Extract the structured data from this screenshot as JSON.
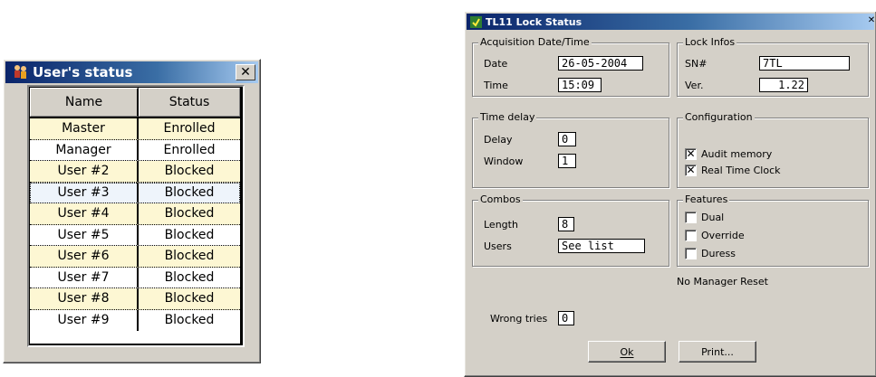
{
  "users_window": {
    "title": "User's status",
    "close_label": "✕",
    "columns": [
      "Name",
      "Status"
    ],
    "rows": [
      {
        "name": "Master",
        "status": "Enrolled"
      },
      {
        "name": "Manager",
        "status": "Enrolled"
      },
      {
        "name": "User #2",
        "status": "Blocked"
      },
      {
        "name": "User #3",
        "status": "Blocked"
      },
      {
        "name": "User #4",
        "status": "Blocked"
      },
      {
        "name": "User #5",
        "status": "Blocked"
      },
      {
        "name": "User #6",
        "status": "Blocked"
      },
      {
        "name": "User #7",
        "status": "Blocked"
      },
      {
        "name": "User #8",
        "status": "Blocked"
      },
      {
        "name": "User #9",
        "status": "Blocked"
      }
    ]
  },
  "lock_window": {
    "title": "TL11 Lock Status",
    "close_label": "✕",
    "acquisition": {
      "title": "Acquisition Date/Time",
      "date_label": "Date",
      "date_value": "26-05-2004",
      "time_label": "Time",
      "time_value": "15:09"
    },
    "lock_infos": {
      "title": "Lock Infos",
      "sn_label": "SN#",
      "sn_value": "7TL",
      "ver_label": "Ver.",
      "ver_value": "1.22"
    },
    "time_delay": {
      "title": "Time delay",
      "delay_label": "Delay",
      "delay_value": "0",
      "window_label": "Window",
      "window_value": "1"
    },
    "configuration": {
      "title": "Configuration",
      "audit_label": "Audit memory",
      "audit_checked": "✕",
      "rtc_label": "Real Time Clock",
      "rtc_checked": "✕"
    },
    "combos": {
      "title": "Combos",
      "length_label": "Length",
      "length_value": "8",
      "users_label": "Users",
      "users_value": "See list"
    },
    "features": {
      "title": "Features",
      "dual_label": "Dual",
      "override_label": "Override",
      "duress_label": "Duress"
    },
    "no_manager_reset": "No Manager Reset",
    "wrong_tries_label": "Wrong tries",
    "wrong_tries_value": "0",
    "ok_label": "Ok",
    "print_label": "Print..."
  }
}
